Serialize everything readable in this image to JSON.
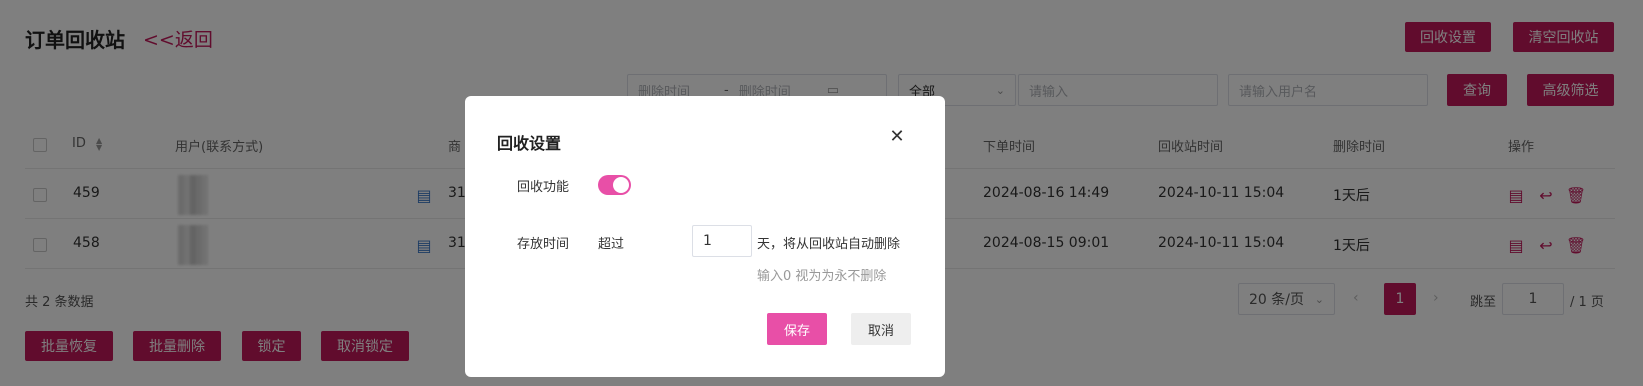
{
  "header": {
    "title": "订单回收站",
    "back_label": "<<返回",
    "recycle_settings_label": "回收设置",
    "clear_recycle_label": "清空回收站"
  },
  "filters": {
    "delete_time_start_placeholder": "删除时间",
    "date_separator": "-",
    "delete_time_end_placeholder": "删除时间",
    "type_select_value": "全部",
    "keyword_placeholder": "请输入",
    "username_placeholder": "请输入用户名",
    "search_label": "查询",
    "advanced_filter_label": "高级筛选"
  },
  "table": {
    "columns": {
      "id": "ID",
      "user": "用户(联系方式)",
      "product": "商",
      "order_time": "下单时间",
      "recycle_time": "回收站时间",
      "delete_time": "删除时间",
      "actions": "操作"
    },
    "rows": [
      {
        "id": "459",
        "product_prefix": "31",
        "order_time": "2024-08-16 14:49",
        "recycle_time": "2024-10-11 15:04",
        "delete_time": "1天后"
      },
      {
        "id": "458",
        "product_prefix": "31",
        "order_time": "2024-08-15 09:01",
        "recycle_time": "2024-10-11 15:04",
        "delete_time": "1天后"
      }
    ]
  },
  "footer": {
    "total_text": "共 2 条数据",
    "page_size": "20 条/页",
    "current_page": "1",
    "jump_label": "跳至",
    "jump_value": "1",
    "total_pages": "/ 1 页",
    "batch_restore_label": "批量恢复",
    "batch_delete_label": "批量删除",
    "lock_label": "锁定",
    "unlock_label": "取消锁定"
  },
  "modal": {
    "title": "回收设置",
    "recycle_function_label": "回收功能",
    "recycle_enabled": true,
    "storage_time_label": "存放时间",
    "over_label": "超过",
    "days_value": "1",
    "days_suffix": "天，将从回收站自动删除",
    "hint": "输入0 视为为永不删除",
    "save_label": "保存",
    "cancel_label": "取消"
  },
  "colors": {
    "primary": "#c2185b",
    "switch_on": "#e84fa7",
    "save_button": "#e84fa7"
  }
}
